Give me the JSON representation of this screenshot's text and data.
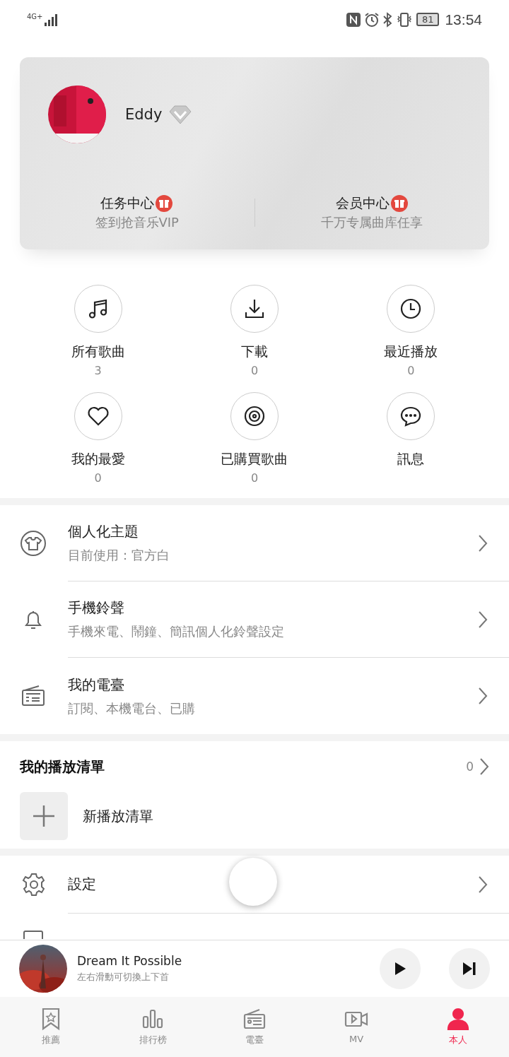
{
  "status_bar": {
    "network": "4G+",
    "battery": "81",
    "time": "13:54"
  },
  "profile": {
    "name": "Eddy",
    "links": [
      {
        "title": "任务中心",
        "subtitle": "签到抢音乐VIP"
      },
      {
        "title": "会员中心",
        "subtitle": "千万专属曲库任享"
      }
    ]
  },
  "quick_items": [
    {
      "label": "所有歌曲",
      "count": "3"
    },
    {
      "label": "下載",
      "count": "0"
    },
    {
      "label": "最近播放",
      "count": "0"
    },
    {
      "label": "我的最愛",
      "count": "0"
    },
    {
      "label": "已購買歌曲",
      "count": "0"
    },
    {
      "label": "訊息"
    }
  ],
  "feature_rows": [
    {
      "title": "個人化主題",
      "subtitle": "目前使用：官方白"
    },
    {
      "title": "手機鈴聲",
      "subtitle": "手機來電、鬧鐘、簡訊個人化鈴聲設定"
    },
    {
      "title": "我的電臺",
      "subtitle": "訂閱、本機電台、已購"
    }
  ],
  "playlists": {
    "title": "我的播放清單",
    "count": "0",
    "new_label": "新播放清單"
  },
  "menu_rows": [
    {
      "title": "設定"
    }
  ],
  "now_playing": {
    "title": "Dream It Possible",
    "hint": "左右滑動可切換上下首"
  },
  "tabs": [
    {
      "label": "推薦",
      "selected": false
    },
    {
      "label": "排行榜",
      "selected": false
    },
    {
      "label": "電臺",
      "selected": false
    },
    {
      "label": "MV",
      "selected": false
    },
    {
      "label": "本人",
      "selected": true
    }
  ]
}
